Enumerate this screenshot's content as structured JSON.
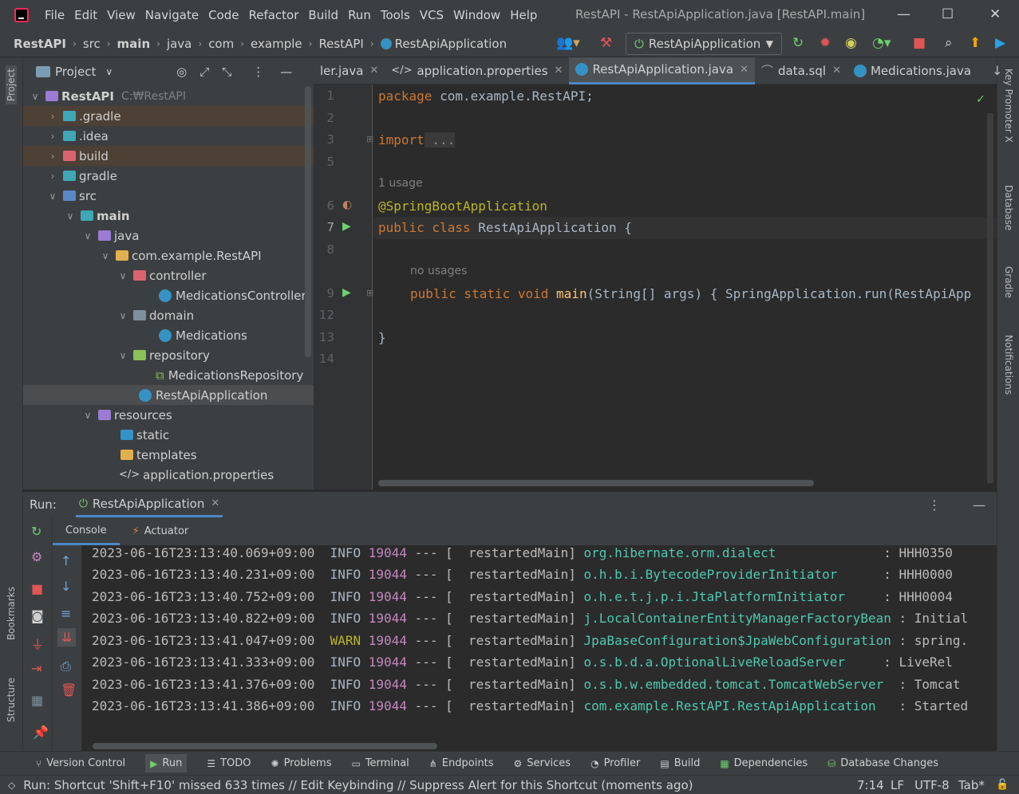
{
  "menu": {
    "items": [
      "File",
      "Edit",
      "View",
      "Navigate",
      "Code",
      "Refactor",
      "Build",
      "Run",
      "Tools",
      "VCS",
      "Window",
      "Help"
    ],
    "window_title": "RestAPI - RestApiApplication.java [RestAPI.main]",
    "minimize": "—",
    "maximize": "☐",
    "close": "✕"
  },
  "breadcrumb": [
    "RestAPI",
    "src",
    "main",
    "java",
    "com",
    "example",
    "RestAPI",
    "RestApiApplication"
  ],
  "run_config": {
    "label": "RestApiApplication"
  },
  "left_strip": {
    "project": "Project",
    "bookmarks": "Bookmarks",
    "structure": "Structure"
  },
  "right_strip": {
    "key_promoter": "Key Promoter X",
    "database": "Database",
    "gradle": "Gradle",
    "notifications": "Notifications"
  },
  "project_panel": {
    "title": "Project",
    "tree": [
      {
        "label": "RestAPI",
        "hint": "C:₩RestAPI"
      },
      {
        "label": ".gradle"
      },
      {
        "label": ".idea"
      },
      {
        "label": "build"
      },
      {
        "label": "gradle"
      },
      {
        "label": "src"
      },
      {
        "label": "main"
      },
      {
        "label": "java"
      },
      {
        "label": "com.example.RestAPI"
      },
      {
        "label": "controller"
      },
      {
        "label": "MedicationsController"
      },
      {
        "label": "domain"
      },
      {
        "label": "Medications"
      },
      {
        "label": "repository"
      },
      {
        "label": "MedicationsRepository"
      },
      {
        "label": "RestApiApplication"
      },
      {
        "label": "resources"
      },
      {
        "label": "static"
      },
      {
        "label": "templates"
      },
      {
        "label": "application.properties"
      }
    ]
  },
  "editor": {
    "tabs": [
      "ler.java",
      "application.properties",
      "RestApiApplication.java",
      "data.sql",
      "Medications.java"
    ],
    "line_numbers": [
      "1",
      "2",
      "3",
      "5",
      "6",
      "7",
      "8",
      "9",
      "12",
      "13",
      "14"
    ],
    "lines": {
      "l1a": "package",
      "l1b": " com.example.RestAPI;",
      "l3a": "import",
      "l3b": " ...",
      "usage1": "1 usage",
      "l6": "@SpringBootApplication",
      "l7a": "public",
      "l7b": " class",
      "l7c": " RestApiApplication",
      "l7d": " {",
      "usage2": "no usages",
      "l9a": "public",
      "l9b": " static",
      "l9c": " void",
      "l9d": " main",
      "l9e": "(String[] args)",
      "l9f": " { SpringApplication.run(RestApiApp",
      "l13": "}"
    }
  },
  "run_panel": {
    "label": "Run:",
    "tab": "RestApiApplication",
    "subtabs": [
      "Console",
      "Actuator"
    ],
    "logs": [
      {
        "ts": "2023-06-16T23:13:40.069+09:00",
        "level": "INFO",
        "pid": "19044",
        "sep": " --- [  restartedMain] ",
        "logger": "org.hibernate.orm.dialect",
        "msg": "              : HHH0350"
      },
      {
        "ts": "2023-06-16T23:13:40.231+09:00",
        "level": "INFO",
        "pid": "19044",
        "sep": " --- [  restartedMain] ",
        "logger": "o.h.b.i.BytecodeProviderInitiator",
        "msg": "      : HHH0000"
      },
      {
        "ts": "2023-06-16T23:13:40.752+09:00",
        "level": "INFO",
        "pid": "19044",
        "sep": " --- [  restartedMain] ",
        "logger": "o.h.e.t.j.p.i.JtaPlatformInitiator",
        "msg": "     : HHH0004"
      },
      {
        "ts": "2023-06-16T23:13:40.822+09:00",
        "level": "INFO",
        "pid": "19044",
        "sep": " --- [  restartedMain] ",
        "logger": "j.LocalContainerEntityManagerFactoryBean",
        "msg": " : Initial"
      },
      {
        "ts": "2023-06-16T23:13:41.047+09:00",
        "level": "WARN",
        "pid": "19044",
        "sep": " --- [  restartedMain] ",
        "logger": "JpaBaseConfiguration$JpaWebConfiguration",
        "msg": " : spring."
      },
      {
        "ts": "2023-06-16T23:13:41.333+09:00",
        "level": "INFO",
        "pid": "19044",
        "sep": " --- [  restartedMain] ",
        "logger": "o.s.b.d.a.OptionalLiveReloadServer",
        "msg": "     : LiveRel"
      },
      {
        "ts": "2023-06-16T23:13:41.376+09:00",
        "level": "INFO",
        "pid": "19044",
        "sep": " --- [  restartedMain] ",
        "logger": "o.s.b.w.embedded.tomcat.TomcatWebServer",
        "msg": "  : Tomcat"
      },
      {
        "ts": "2023-06-16T23:13:41.386+09:00",
        "level": "INFO",
        "pid": "19044",
        "sep": " --- [  restartedMain] ",
        "logger": "com.example.RestAPI.RestApiApplication",
        "msg": "   : Started"
      }
    ]
  },
  "bottom_tabs": [
    "Version Control",
    "Run",
    "TODO",
    "Problems",
    "Terminal",
    "Endpoints",
    "Services",
    "Profiler",
    "Build",
    "Dependencies",
    "Database Changes"
  ],
  "status": {
    "message": "Run: Shortcut 'Shift+F10' missed 633 times // Edit Keybinding // Suppress Alert for this Shortcut (moments ago)",
    "position": "7:14",
    "line_sep": "LF",
    "encoding": "UTF-8",
    "indent": "Tab*"
  }
}
